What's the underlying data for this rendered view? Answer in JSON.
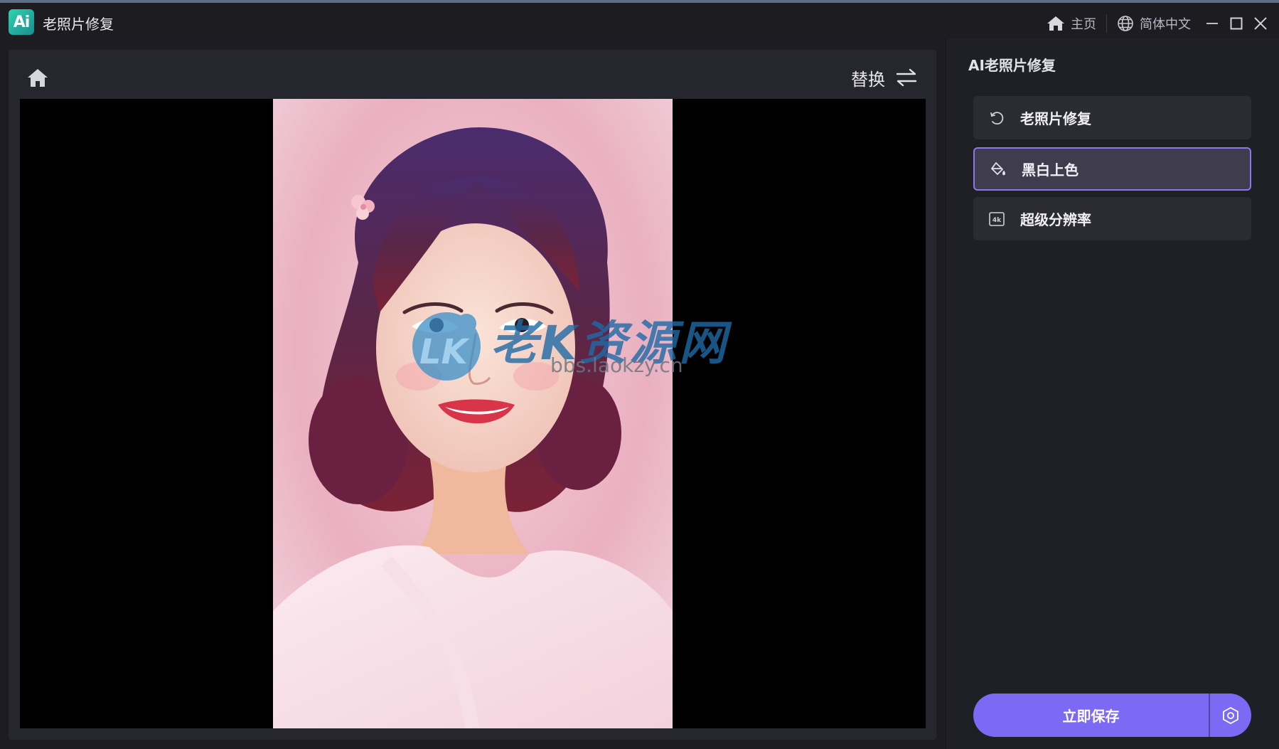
{
  "window": {
    "app_logo_text": "Ai",
    "title": "老照片修复",
    "home_label": "主页",
    "language_label": "简体中文"
  },
  "workspace": {
    "replace_label": "替换",
    "watermark": {
      "logo_text": "LK",
      "site_name": "老K资源网",
      "url": "bbs.laokzy.cn"
    }
  },
  "panel": {
    "title": "AI老照片修复",
    "features": [
      {
        "label": "老照片修复",
        "icon": "restore-icon",
        "selected": false
      },
      {
        "label": "黑白上色",
        "icon": "paint-bucket-icon",
        "selected": true
      },
      {
        "label": "超级分辨率",
        "icon": "4k-icon",
        "selected": false
      }
    ],
    "save_label": "立即保存"
  },
  "colors": {
    "accent": "#7c6af5",
    "selected_border": "#8877ee",
    "background": "#1c1c22"
  }
}
